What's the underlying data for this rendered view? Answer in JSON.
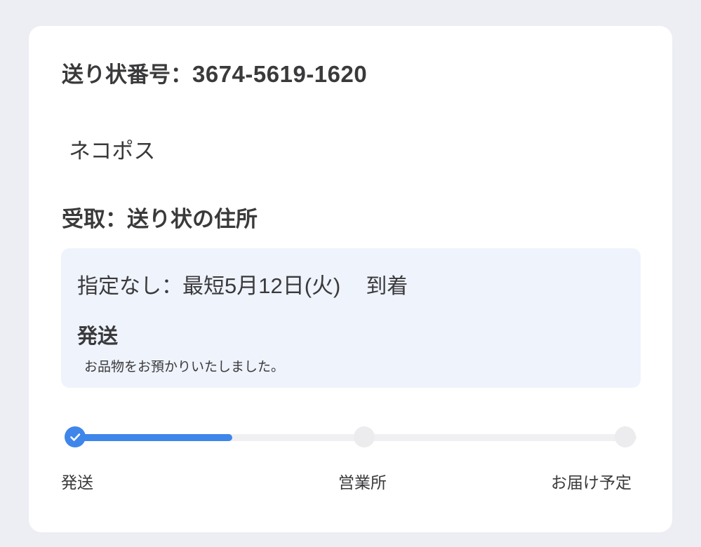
{
  "shipment": {
    "tracking_label": "送り状番号：",
    "tracking_number": "3674-5619-1620",
    "service": "ネコポス",
    "receive": "受取：送り状の住所"
  },
  "status_box": {
    "delivery_prefix": "指定なし：最短",
    "delivery_date": "5月12日(火)",
    "delivery_suffix": "到着",
    "status_title": "発送",
    "status_detail": "お品物をお預かりいたしました。"
  },
  "progress": {
    "fraction_filled": 0.28,
    "steps": [
      {
        "label": "発送",
        "done": true
      },
      {
        "label": "営業所",
        "done": false
      },
      {
        "label": "お届け予定",
        "done": false
      }
    ]
  },
  "colors": {
    "accent": "#3f86ea",
    "background": "#eceef4",
    "status_box": "#eff3fc"
  }
}
